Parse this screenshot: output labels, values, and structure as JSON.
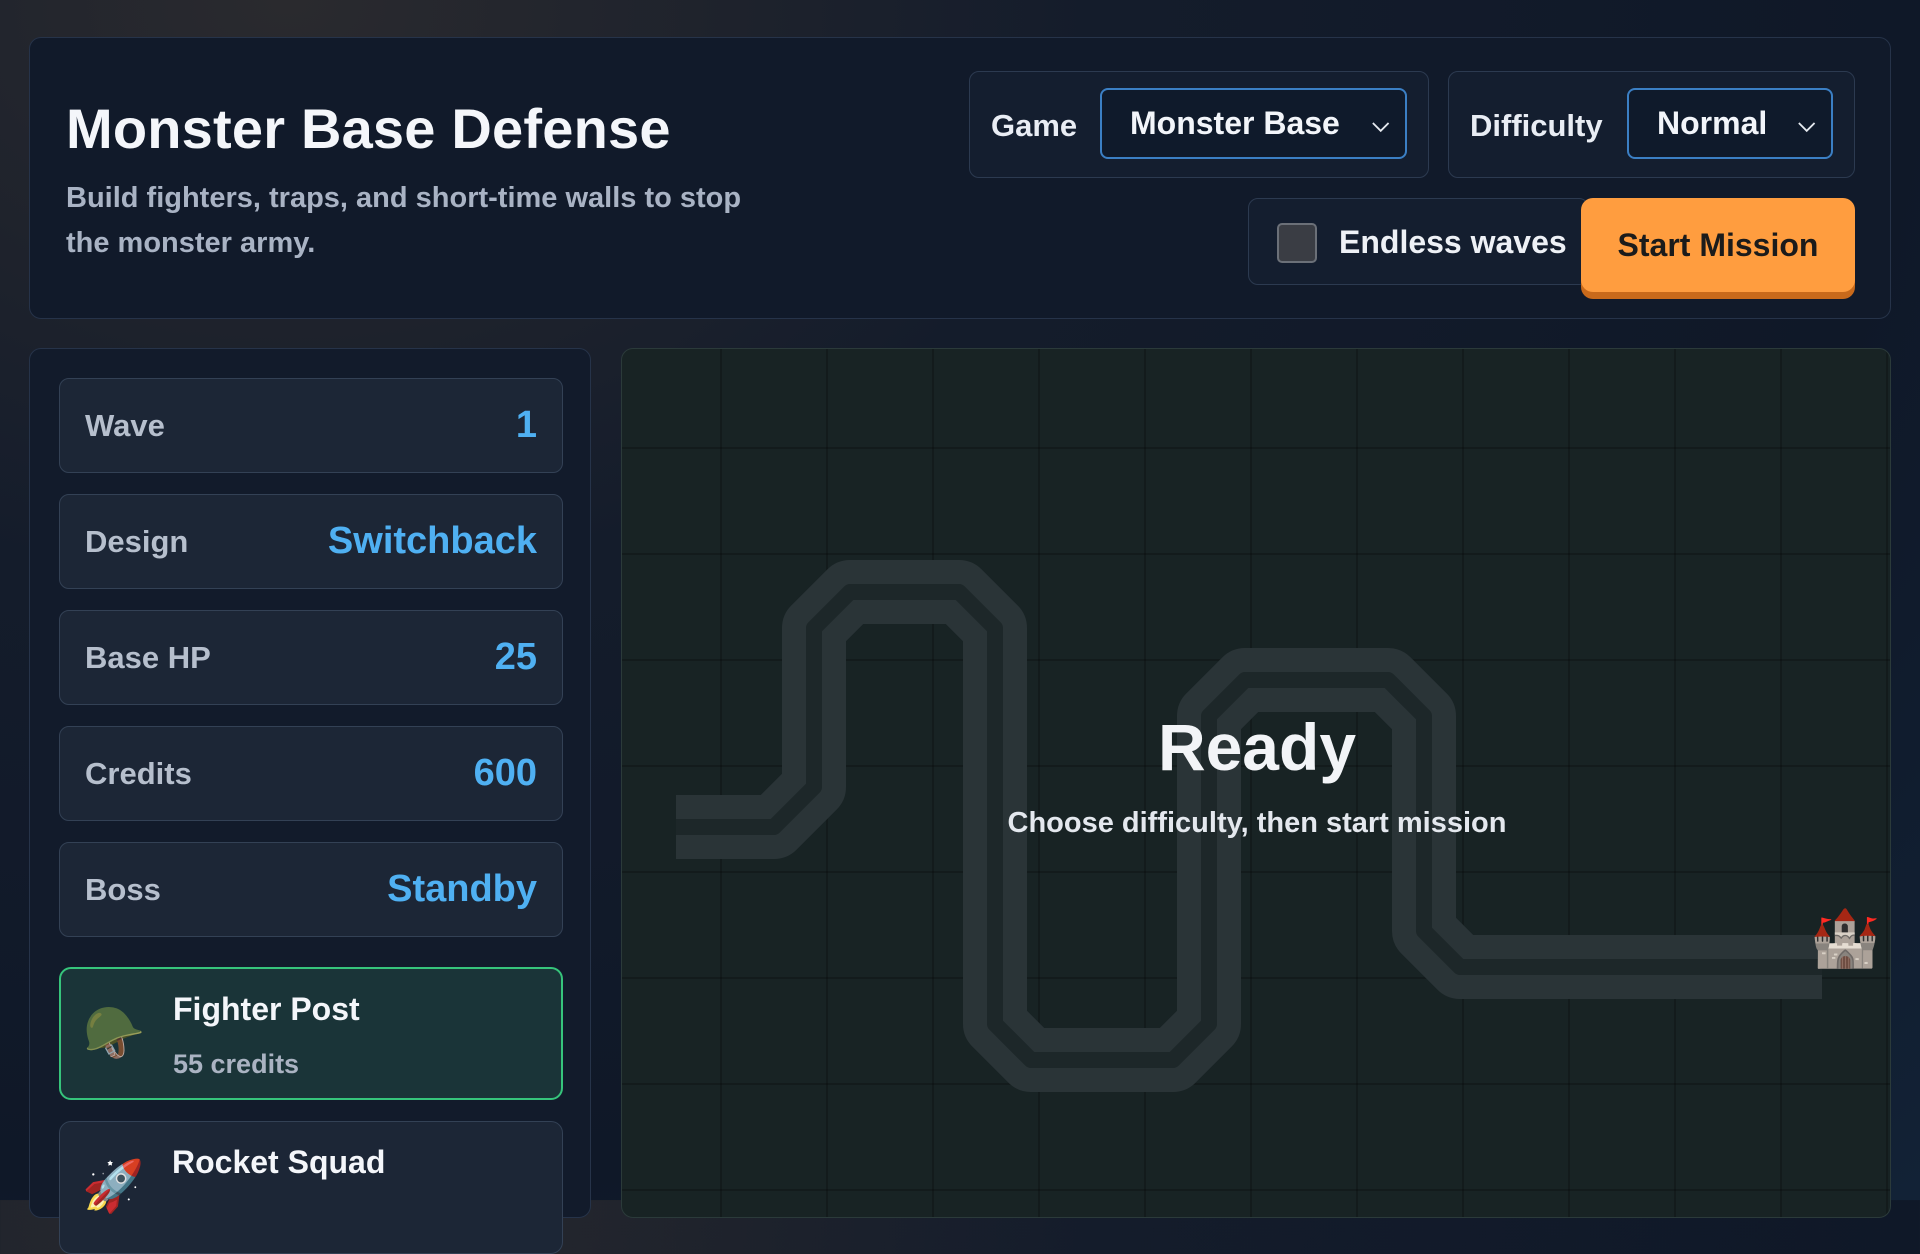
{
  "header": {
    "title": "Monster Base Defense",
    "subtitle": "Build fighters, traps, and short-time walls to stop the monster army."
  },
  "controls": {
    "game_label": "Game",
    "game_value": "Monster Base",
    "difficulty_label": "Difficulty",
    "difficulty_value": "Normal",
    "endless_label": "Endless waves",
    "endless_checked": false,
    "start_label": "Start Mission"
  },
  "stats": [
    {
      "label": "Wave",
      "value": "1"
    },
    {
      "label": "Design",
      "value": "Switchback"
    },
    {
      "label": "Base HP",
      "value": "25"
    },
    {
      "label": "Credits",
      "value": "600"
    },
    {
      "label": "Boss",
      "value": "Standby"
    }
  ],
  "units": [
    {
      "name": "Fighter Post",
      "cost": "55 credits",
      "icon": "🪖",
      "icon_name": "helmet-icon",
      "selected": true
    },
    {
      "name": "Rocket Squad",
      "cost": "",
      "icon": "🚀",
      "icon_name": "rocket-icon",
      "selected": false
    }
  ],
  "board": {
    "status_title": "Ready",
    "status_hint": "Choose difficulty, then start mission",
    "base_icon": "🏰",
    "base_icon_name": "castle-icon"
  },
  "colors": {
    "accent": "#4fb0f2",
    "start_button": "#ff9d3f",
    "selected_border": "#36c47b"
  }
}
